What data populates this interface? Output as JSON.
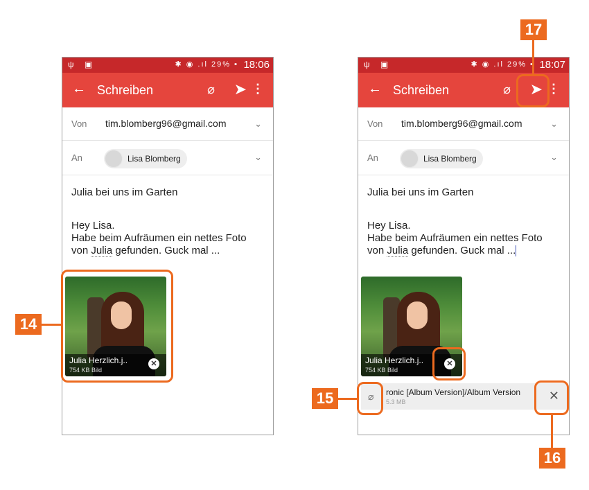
{
  "left_phone": {
    "status": {
      "left_icons": "ψ ▣",
      "icons": "✱ ◉ .ıl 29% ▪",
      "time": "18:06"
    },
    "appbar": {
      "back_icon": "arrow-back-icon",
      "title": "Schreiben",
      "clip_icon": "attach-icon",
      "send_icon": "send-icon",
      "more_icon": "more-vert-icon"
    },
    "from": {
      "label": "Von",
      "value": "tim.blomberg96@gmail.com"
    },
    "to": {
      "label": "An",
      "recipient": "Lisa Blomberg"
    },
    "subject": "Julia bei uns im Garten",
    "body": {
      "line1": "Hey Lisa.",
      "line2": "Habe beim Aufräumen ein nettes Foto",
      "line3_pre": "von ",
      "line3_link": "Julia",
      "line3_post": " gefunden. Guck mal ..."
    },
    "attachment_photo": {
      "name": "Julia Herzlich.j..",
      "size": "754 KB Bild"
    }
  },
  "right_phone": {
    "status": {
      "left_icons": "ψ ▣",
      "icons": "✱ ◉ .ıl 29% ▪",
      "time": "18:07"
    },
    "appbar": {
      "title": "Schreiben"
    },
    "from": {
      "label": "Von",
      "value": "tim.blomberg96@gmail.com"
    },
    "to": {
      "label": "An",
      "recipient": "Lisa Blomberg"
    },
    "subject": "Julia bei uns im Garten",
    "body": {
      "line1": "Hey Lisa.",
      "line2": "Habe beim Aufräumen ein nettes Foto",
      "line3_pre": "von ",
      "line3_link": "Julia",
      "line3_post": " gefunden. Guck mal ..."
    },
    "attachment_photo": {
      "name": "Julia Herzlich.j..",
      "size": "754 KB Bild"
    },
    "attachment_audio": {
      "name": "ronic [Album Version]/Album Version",
      "size": "5.3 MB"
    }
  },
  "callouts": {
    "c14": "14",
    "c15": "15",
    "c16": "16",
    "c17": "17"
  },
  "colors": {
    "accent": "#ec6a1f",
    "appbar": "#e5453d",
    "statusbar": "#c6282a"
  }
}
